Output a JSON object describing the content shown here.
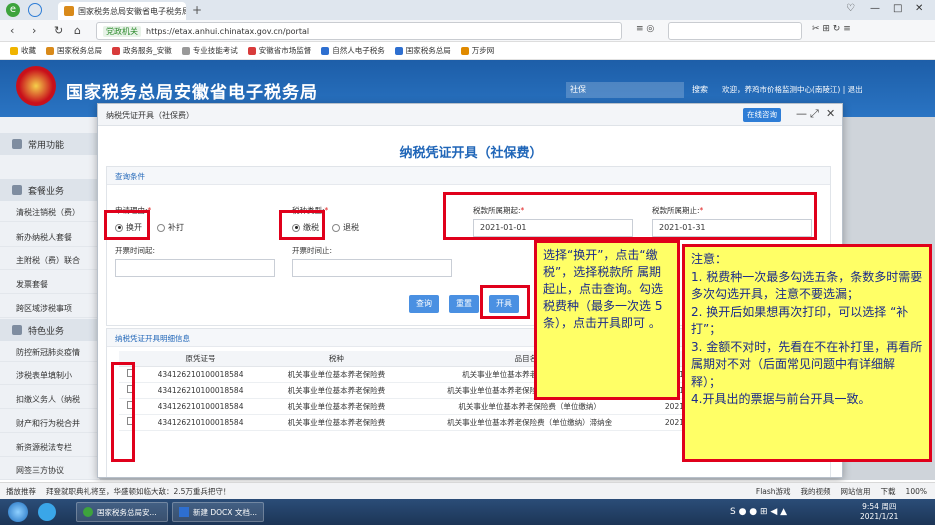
{
  "browser": {
    "tab_title": "国家税务总局安徽省电子税务局",
    "address_secure": "党政机关",
    "address_url": "https://etax.anhui.chinatax.gov.cn/portal",
    "bookmarks": [
      "收藏",
      "国家税务总局",
      "政务服务_安徽",
      "专业技能考试",
      "安徽省市场监督",
      "自然人电子税务",
      "国家税务总局",
      "万步网"
    ]
  },
  "site": {
    "title": "国家税务总局安徽省电子税务局",
    "search_value": "社保",
    "search_btn": "搜索",
    "welcome": "欢迎，养鸡市价格监测中心(南陵江) | 退出"
  },
  "sidebar": {
    "sec_common": "常用功能",
    "sec_tax": "套餐业务",
    "sec_special": "特色业务",
    "items_tax": [
      "清税注销税（费）",
      "新办纳税人套餐",
      "主附税（费）联合",
      "发票套餐",
      "跨区域涉税事项"
    ],
    "items_special": [
      "防控新冠肺炎疫情",
      "涉税表单填制小",
      "扣缴义务人（纳税",
      "财产和行为税合并",
      "新资源税法专栏",
      "网签三方协议"
    ]
  },
  "modal": {
    "window_title": "纳税凭证开具（社保费）",
    "service_btn": "在线咨询",
    "heading": "纳税凭证开具（社保费）",
    "query_header": "查询条件",
    "reason_label": "申请理由:",
    "reason_opt1": "换开",
    "reason_opt2": "补打",
    "kind_label": "税种类型:",
    "kind_opt1": "缴税",
    "kind_opt2": "退税",
    "period_start_label": "税款所属期起:",
    "period_start_value": "2021-01-01",
    "period_end_label": "税款所属期止:",
    "period_end_value": "2021-01-31",
    "issue_start_label": "开票时间起:",
    "issue_end_label": "开票时间止:",
    "btn_query": "查询",
    "btn_reset": "重置",
    "btn_issue": "开具",
    "detail_header": "纳税凭证开具明细信息",
    "columns": [
      "",
      "原凭证号",
      "税种",
      "品目名称",
      "所"
    ],
    "rows": [
      [
        "434126210100018584",
        "机关事业单位基本养老保险费",
        "机关事业单位基本养老保险费（个人缴纳",
        "2021-01-01"
      ],
      [
        "434126210100018584",
        "机关事业单位基本养老保险费",
        "机关事业单位基本养老保险费（个人缴纳）滞纳金",
        "2021-01-01"
      ],
      [
        "434126210100018584",
        "机关事业单位基本养老保险费",
        "机关事业单位基本养老保险费（单位缴纳）",
        "2021-01-01"
      ],
      [
        "434126210100018584",
        "机关事业单位基本养老保险费",
        "机关事业单位基本养老保险费（单位缴纳）滞纳金",
        "2021-01-01"
      ]
    ]
  },
  "callout_mid": "选择“换开”，点击“缴税”，选择税款所 属期起止，点击查询。勾选税费种（最多一次选 5 条），点击开具即可 。",
  "callout_right": "注意：\n1. 税费种一次最多勾选五条，条数多时需要多次勾选开具，注意不要选漏；\n2. 换开后如果想再次打印，可以选择 “补打”；\n3. 金额不对时，先看在不在补打里，再看所属期对不对（后面常见问题中有详细解释）；\n4.开具出的票据与前台开具一致。",
  "statusbar": {
    "left1": "播放推荐",
    "left2": "拜登就职典礼将至，华盛顿如临大敌：2.5万重兵把守！",
    "right": [
      "Flash游戏",
      "我的视频",
      "网站信用",
      "下载",
      "100%"
    ]
  },
  "taskbar": {
    "win1": "国家税务总局安...",
    "win2": "新建 DOCX 文档...",
    "time": "9:54 周四",
    "date": "2021/1/21"
  }
}
